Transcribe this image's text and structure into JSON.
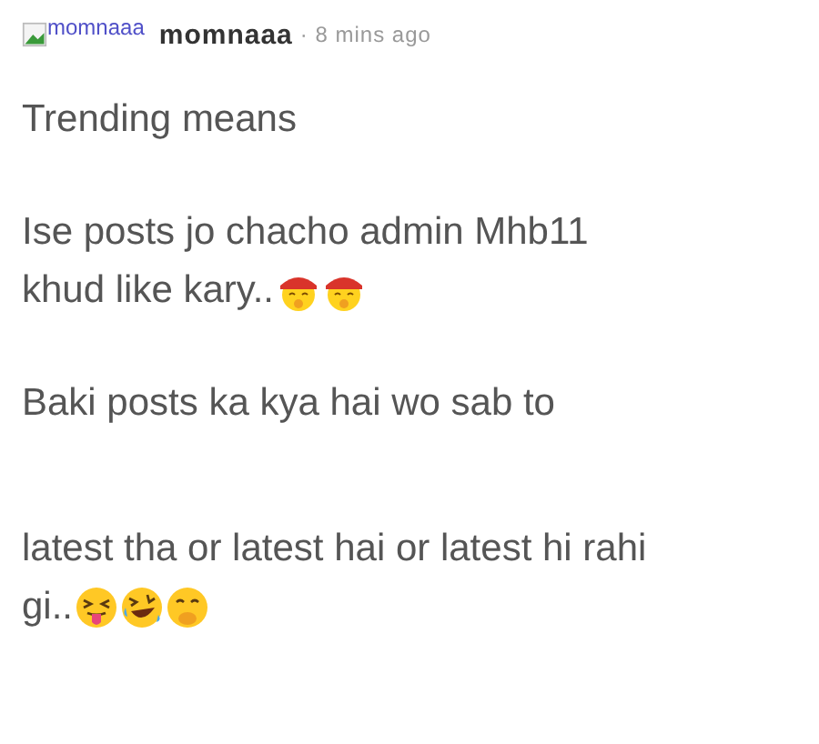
{
  "header": {
    "avatar_alt": "momnaaa",
    "username": "momnaaa",
    "meta": "· 8 mins ago"
  },
  "paragraphs": [
    {
      "lines": [
        {
          "text": "Trending means"
        }
      ]
    },
    {
      "lines": [
        {
          "text": "Ise posts jo chacho admin Mhb11"
        },
        {
          "text": "khud like kary..",
          "emojis": [
            {
              "kind": "hat-smile"
            },
            {
              "kind": "hat-smile"
            }
          ]
        }
      ]
    },
    {
      "lines": [
        {
          "text": "Baki posts ka kya hai wo sab to"
        }
      ]
    },
    {
      "lines": [
        {
          "text": "latest tha or latest hai or latest hi rahi"
        },
        {
          "text": "gi..",
          "emojis": [
            {
              "kind": "tongue-squint"
            },
            {
              "kind": "rofl"
            },
            {
              "kind": "hand-over-mouth"
            }
          ]
        }
      ]
    }
  ]
}
